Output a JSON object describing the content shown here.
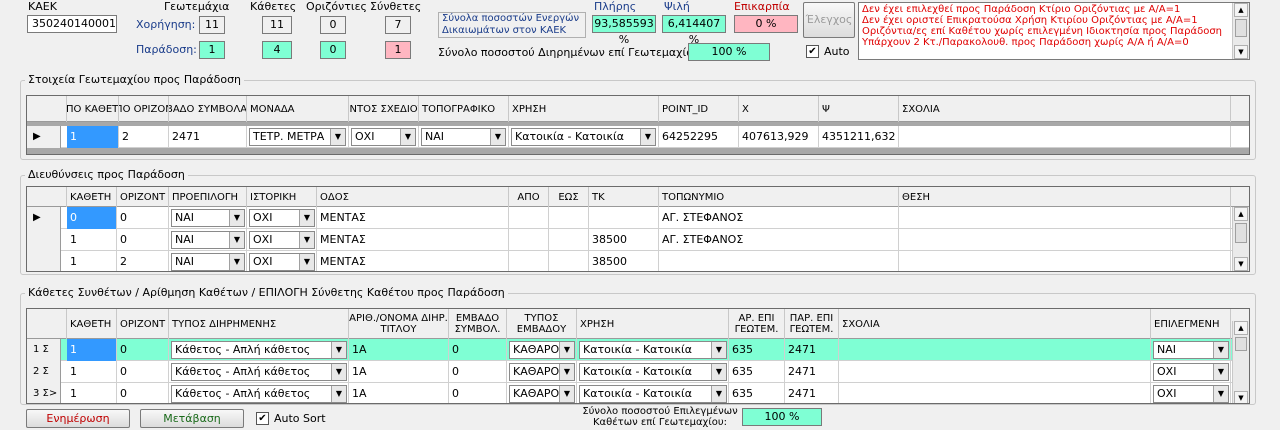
{
  "top": {
    "kaek_label": "ΚΑΕΚ",
    "kaek_value": "350240140001",
    "col_headers": [
      "Γεωτεμάχια",
      "Κάθετες",
      "Οριζόντιες",
      "Σύνθετες"
    ],
    "row_labels": {
      "assign": "Χορήγηση:",
      "delivery": "Παράδοση:"
    },
    "assign_values": [
      "11",
      "11",
      "0",
      "7"
    ],
    "delivery_values": [
      "1",
      "4",
      "0",
      "1"
    ],
    "totals_label": "Σύνολα ποσοστών Ενεργών Δικαιωμάτων στον ΚΑΕΚ",
    "pct_headers": {
      "full": "Πλήρης",
      "bare": "Ψιλή",
      "usufruct": "Επικαρπία"
    },
    "pct_values": {
      "full": "93,585593 %",
      "bare": "6,414407 %",
      "usufruct": "0 %"
    },
    "shared_label": "Σύνολο ποσοστού Διηρημένων επί Γεωτεμαχίου:",
    "shared_value": "100 %",
    "check_button": "Έλεγχος",
    "auto_label": "Auto",
    "auto_checked": true,
    "messages": [
      "Δεν έχει επιλεχθεί προς Παράδοση Κτίριο Οριζόντιας με Α/Α=1",
      "Δεν έχει οριστεί Επικρατούσα Χρήση Κτιρίου Οριζόντιας με Α/Α=1",
      "Οριζόντια/ες επί Καθέτου χωρίς επιλεγμένη Ιδιοκτησία προς Παράδοση",
      "Υπάρχουν 2 Κτ./Παρακολουθ. προς Παράδοση χωρίς Α/Α ή Α/Α=0"
    ]
  },
  "parcel": {
    "title": "Στοιχεία Γεωτεμαχίου προς Παράδοση",
    "headers": [
      "ΑΠΟ ΚΑΘΕΤΗ",
      "ΑΠΟ ΟΡΙΖΟΝΤ",
      "ΕΜΒΑΔΟ ΣΥΜΒΟΛΑΙΟΥ",
      "ΜΟΝΑΔΑ",
      "ΕΝΤΟΣ ΣΧΕΔΙΟΥ",
      "ΤΟΠΟΓΡΑΦΙΚΟ",
      "ΧΡΗΣΗ",
      "POINT_ID",
      "Χ",
      "Ψ",
      "ΣΧΟΛΙΑ"
    ],
    "row": [
      "1",
      "2",
      "2471",
      "ΤΕΤΡ. ΜΕΤΡΑ",
      "ΟΧΙ",
      "ΝΑΙ",
      "Κατοικία - Κατοικία",
      "64252295",
      "407613,929",
      "4351211,632",
      ""
    ]
  },
  "addresses": {
    "title": "Διευθύνσεις προς Παράδοση",
    "headers": [
      "ΚΑΘΕΤΗ",
      "ΟΡΙΖΟΝΤ",
      "ΠΡΟΕΠΙΛΟΓΗ",
      "ΙΣΤΟΡΙΚΗ",
      "ΟΔΟΣ",
      "ΑΠΟ",
      "ΕΩΣ",
      "ΤΚ",
      "ΤΟΠΩΝΥΜΙΟ",
      "ΘΕΣΗ"
    ],
    "rows": [
      [
        "0",
        "0",
        "ΝΑΙ",
        "ΟΧΙ",
        "ΜΕΝΤΑΣ",
        "",
        "",
        "",
        "ΑΓ. ΣΤΕΦΑΝΟΣ",
        ""
      ],
      [
        "1",
        "0",
        "ΝΑΙ",
        "ΟΧΙ",
        "ΜΕΝΤΑΣ",
        "",
        "",
        "38500",
        "ΑΓ. ΣΤΕΦΑΝΟΣ",
        ""
      ],
      [
        "1",
        "2",
        "ΝΑΙ",
        "ΟΧΙ",
        "ΜΕΝΤΑΣ",
        "",
        "",
        "38500",
        "",
        ""
      ]
    ]
  },
  "composite": {
    "title": "Κάθετες Συνθέτων / Αρίθμηση Καθέτων / ΕΠΙΛΟΓΗ Σύνθετης Καθέτου προς Παράδοση",
    "headers": [
      "ΚΑΘΕΤΗ",
      "ΟΡΙΖΟΝΤ",
      "ΤΥΠΟΣ ΔΙΗΡΗΜΕΝΗΣ",
      "ΑΡΙΘ./ΟΝΟΜΑ ΔΙΗΡ. ΤΙΤΛΟΥ",
      "ΕΜΒΑΔΟ ΣΥΜΒΟΛ.",
      "ΤΥΠΟΣ ΕΜΒΑΔΟΥ",
      "ΧΡΗΣΗ",
      "ΑΡ. ΕΠΙ ΓΕΩΤΕΜ.",
      "ΠΑΡ. ΕΠΙ ΓΕΩΤΕΜ.",
      "ΣΧΟΛΙΑ",
      "ΕΠΙΛΕΓΜΕΝΗ"
    ],
    "rows": [
      {
        "rh": "1 Σ",
        "cells": [
          "1",
          "0",
          "Κάθετος - Απλή κάθετος",
          "1Α",
          "0",
          "ΚΑΘΑΡΟ",
          "Κατοικία - Κατοικία",
          "635",
          "2471",
          "",
          "ΝΑΙ"
        ]
      },
      {
        "rh": "2 Σ",
        "cells": [
          "1",
          "0",
          "Κάθετος - Απλή κάθετος",
          "1Α",
          "0",
          "ΚΑΘΑΡΟ",
          "Κατοικία - Κατοικία",
          "635",
          "2471",
          "",
          "ΟΧΙ"
        ]
      },
      {
        "rh": "3 Σ>",
        "cells": [
          "1",
          "0",
          "Κάθετος - Απλή κάθετος",
          "1Α",
          "0",
          "ΚΑΘΑΡΟ",
          "Κατοικία - Κατοικία",
          "635",
          "2471",
          "",
          "ΟΧΙ"
        ]
      }
    ]
  },
  "bottom": {
    "update_button": "Ενημέρωση",
    "go_button": "Μετάβαση",
    "autosort_label": "Auto Sort",
    "autosort_checked": true,
    "selected_label": "Σύνολο ποσοστού Επιλεγμένων Καθέτων επί Γεωτεμαχίου:",
    "selected_value": "100 %"
  },
  "colors": {
    "selection": "#3399ff",
    "highlight": "#7fffd4",
    "warn": "#ffb6c1",
    "messages": "#e00000",
    "label_blue": "#1a3c8a",
    "action": "#c00000"
  }
}
